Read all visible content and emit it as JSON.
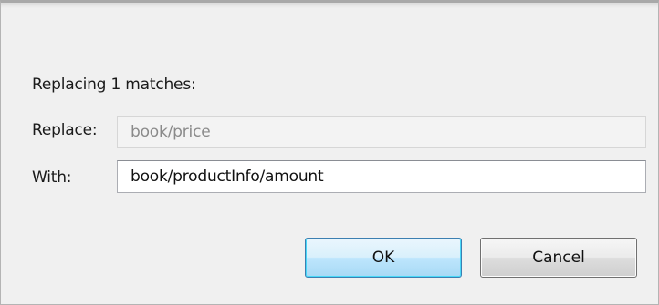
{
  "dialog": {
    "message": "Replacing 1 matches:",
    "replace_label": "Replace:",
    "replace_value": "book/price",
    "with_label": "With:",
    "with_value": "book/productInfo/amount",
    "ok_label": "OK",
    "cancel_label": "Cancel"
  }
}
